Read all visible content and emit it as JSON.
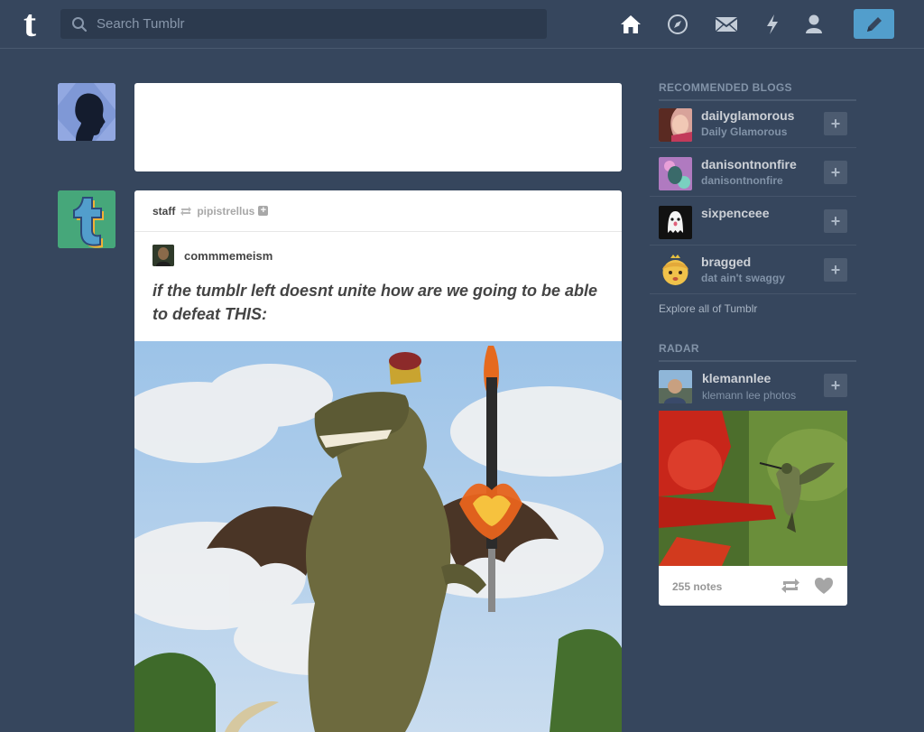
{
  "topbar": {
    "logo_letter": "t",
    "search_placeholder": "Search Tumblr",
    "nav_icons": [
      "home-icon",
      "explore-compass-icon",
      "inbox-envelope-icon",
      "activity-lightning-icon",
      "account-person-icon"
    ],
    "compose_icon": "pencil-icon",
    "accent_color": "#529ecc",
    "background_color": "#36465d"
  },
  "post": {
    "author": "staff",
    "reblogged_from": "pipistrellus",
    "reblog_author": "commmemeism",
    "title": "if the tumblr left doesnt unite how are we going to be able to defeat THIS:"
  },
  "sidebar": {
    "recommended_heading": "RECOMMENDED BLOGS",
    "blogs": [
      {
        "name": "dailyglamorous",
        "title": "Daily Glamorous"
      },
      {
        "name": "danisontnonfire",
        "title": "danisontnonfire"
      },
      {
        "name": "sixpenceee",
        "title": ""
      },
      {
        "name": "bragged",
        "title": "dat ain't swaggy"
      }
    ],
    "explore_link": "Explore all of Tumblr",
    "radar_heading": "RADAR",
    "radar": {
      "name": "klemannlee",
      "title": "klemann lee photos",
      "notes": "255 notes"
    }
  }
}
